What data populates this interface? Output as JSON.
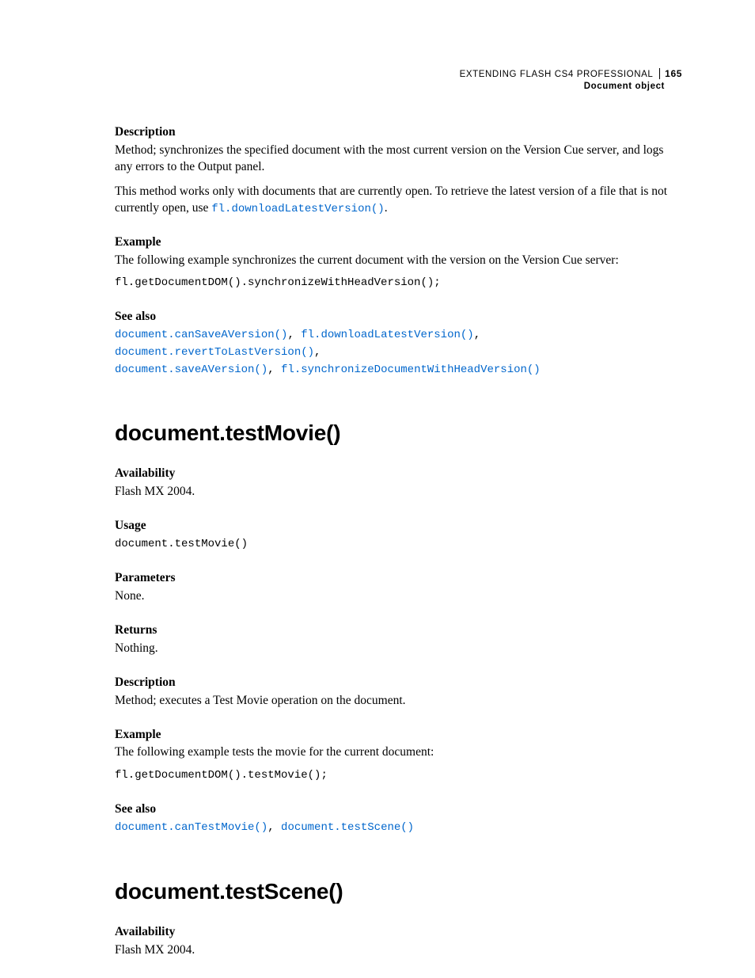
{
  "header": {
    "book_title": "EXTENDING FLASH CS4 PROFESSIONAL",
    "page_number": "165",
    "chapter": "Document object"
  },
  "section1": {
    "desc_label": "Description",
    "desc_p1": "Method; synchronizes the specified document with the most current version on the Version Cue server, and logs any errors to the Output panel.",
    "desc_p2a": "This method works only with documents that are currently open. To retrieve the latest version of a file that is not currently open, use ",
    "desc_link": "fl.downloadLatestVersion()",
    "desc_p2b": ".",
    "example_label": "Example",
    "example_p": "The following example synchronizes the current document with the version on the Version Cue server:",
    "example_code": "fl.getDocumentDOM().synchronizeWithHeadVersion();",
    "seealso_label": "See also",
    "links": {
      "l1": "document.canSaveAVersion()",
      "l2": "fl.downloadLatestVersion()",
      "l3": "document.revertToLastVersion()",
      "l4": "document.saveAVersion()",
      "l5": "fl.synchronizeDocumentWithHeadVersion()"
    }
  },
  "section2": {
    "heading": "document.testMovie()",
    "avail_label": "Availability",
    "avail_text": "Flash MX 2004.",
    "usage_label": "Usage",
    "usage_code": "document.testMovie()",
    "params_label": "Parameters",
    "params_text": "None.",
    "returns_label": "Returns",
    "returns_text": "Nothing.",
    "desc_label": "Description",
    "desc_text": "Method; executes a Test Movie operation on the document.",
    "example_label": "Example",
    "example_p": "The following example tests the movie for the current document:",
    "example_code": "fl.getDocumentDOM().testMovie();",
    "seealso_label": "See also",
    "links": {
      "l1": "document.canTestMovie()",
      "l2": "document.testScene()"
    }
  },
  "section3": {
    "heading": "document.testScene()",
    "avail_label": "Availability",
    "avail_text": "Flash MX 2004."
  }
}
